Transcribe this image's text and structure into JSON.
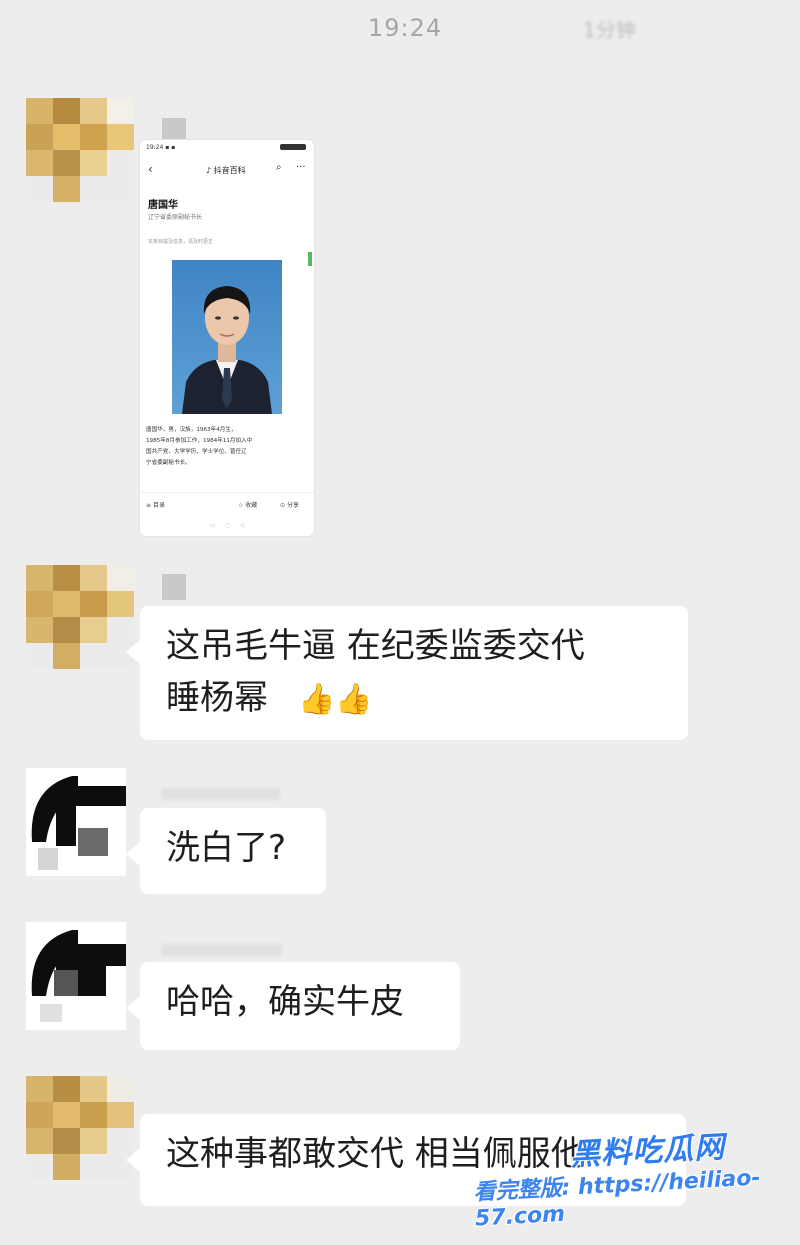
{
  "header": {
    "time": "19:24",
    "sub": "1分钟"
  },
  "screenshot_card": {
    "app_title": "抖音百科",
    "person_name": "唐国华",
    "subtitle": "辽宁省委原副秘书长",
    "hint": "本条目提及信息，请及时更正",
    "bio_lines": [
      "唐国华，男，汉族，1963年4月生，",
      "1985年8月参加工作，1984年11月加入中",
      "国共产党，大学学历，学士学位。曾任辽",
      "宁省委副秘书长。"
    ],
    "footer": {
      "left": "目录",
      "mid": "收藏",
      "right": "分享"
    }
  },
  "messages": [
    {
      "text_line1": "这吊毛牛逼   在纪委监委交代",
      "text_line2": "睡杨幂",
      "emoji": "👍👍"
    },
    {
      "text": "洗白了?"
    },
    {
      "text": "哈哈，确实牛皮"
    },
    {
      "text": "这种事都敢交代   相当佩服他"
    }
  ],
  "watermark": {
    "brand": "黑料吃瓜网",
    "line": "看完整版: https://heiliao-57.com"
  },
  "colors": {
    "background": "#ededed",
    "bubble": "#ffffff",
    "watermark": "#2f7df0"
  }
}
